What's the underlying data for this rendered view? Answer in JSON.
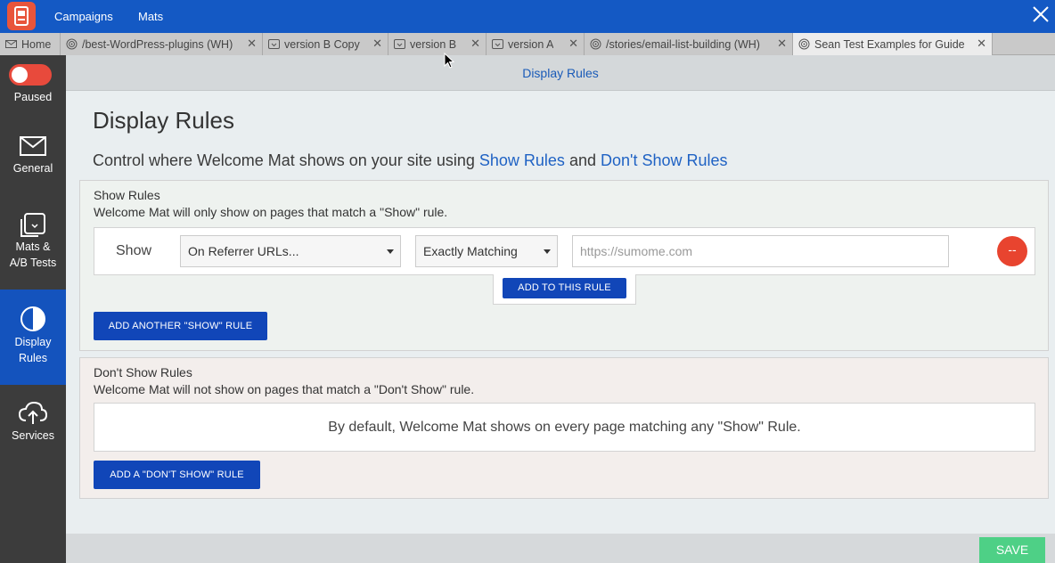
{
  "topbar": {
    "nav": [
      "Campaigns",
      "Mats"
    ],
    "brand_color": "#1459c4"
  },
  "tabs": [
    {
      "label": "Home",
      "icon": "mail-icon"
    },
    {
      "label": "/best-WordPress-plugins (WH)",
      "icon": "target-icon"
    },
    {
      "label": "version B Copy",
      "icon": "mat-icon"
    },
    {
      "label": "version B",
      "icon": "mat-icon"
    },
    {
      "label": "version A",
      "icon": "mat-icon"
    },
    {
      "label": "/stories/email-list-building (WH)",
      "icon": "target-icon"
    },
    {
      "label": "Sean Test Examples for Guide",
      "icon": "target-icon",
      "active": true
    }
  ],
  "sidebar": {
    "toggle_label": "Paused",
    "toggle_state": "off",
    "items": [
      {
        "label": "General",
        "icon": "envelope-icon"
      },
      {
        "label": "Mats &",
        "label2": "A/B Tests",
        "icon": "mats-icon"
      },
      {
        "label": "Display",
        "label2": "Rules",
        "icon": "half-circle-icon",
        "active": true
      },
      {
        "label": "Services",
        "icon": "cloud-upload-icon"
      }
    ]
  },
  "breadcrumb": "Display Rules",
  "page": {
    "title": "Display Rules",
    "subtitle_prefix": "Control where Welcome Mat shows on your site using",
    "subtitle_link1": "Show Rules",
    "subtitle_and": "and",
    "subtitle_link2": "Don't Show Rules"
  },
  "show_rules": {
    "title": "Show Rules",
    "description": "Welcome Mat will only show on pages that match a \"Show\" rule.",
    "rule": {
      "label": "Show",
      "type_select": "On Referrer URLs...",
      "match_select": "Exactly Matching",
      "url_placeholder": "https://sumome.com",
      "url_value": "",
      "remove_symbol": "--"
    },
    "add_to_rule": "ADD TO THIS RULE",
    "add_another": "ADD ANOTHER \"SHOW\" RULE"
  },
  "dont_show_rules": {
    "title": "Don't Show Rules",
    "description": "Welcome Mat will not show on pages that match a \"Don't Show\" rule.",
    "default_text": "By default, Welcome Mat shows on every page matching any \"Show\" Rule.",
    "add_button": "ADD A \"DON'T SHOW\" RULE"
  },
  "footer": {
    "save": "SAVE",
    "save_color": "#4ed086"
  }
}
